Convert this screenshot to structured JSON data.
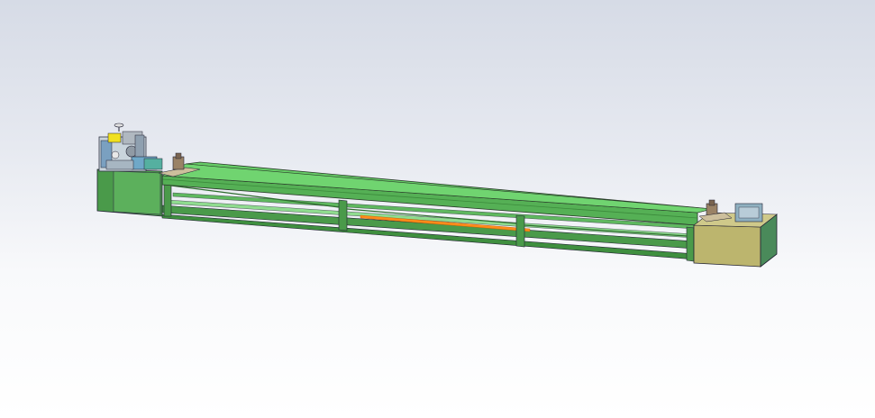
{
  "view": {
    "background_top": "#d6dbe6",
    "background_bottom": "#ffffff"
  },
  "model": {
    "conveyor_color": "#66cc66",
    "frame_color": "#4a9a4a",
    "end_box_color": "#bcb56e",
    "rail_accent_color": "#ff8c1a",
    "motor_color": "#6fa8c8",
    "label_color": "#f0e020"
  }
}
